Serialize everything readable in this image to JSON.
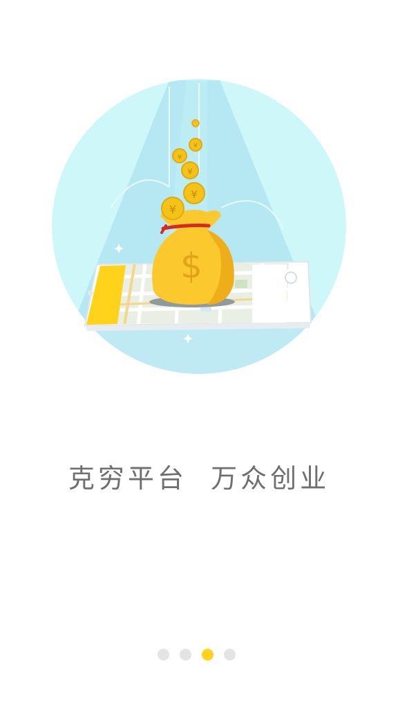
{
  "onboarding": {
    "slogan": "克穷平台  万众创业",
    "current_page": 3,
    "page_count": 4,
    "illustration": {
      "subject": "money-bag-on-phone-map",
      "bag_symbol": "$",
      "coin_symbol": "¥"
    }
  },
  "colors": {
    "circle_bg": "#cdf7f8",
    "beam": "#b5e8f2",
    "bag": "#fbc82d",
    "bag_shadow": "#eeae1a",
    "coin": "#f5c318",
    "accent_yellow": "#ffd31c",
    "dot_inactive": "#e4e4e4",
    "text": "#6f6f6f"
  }
}
